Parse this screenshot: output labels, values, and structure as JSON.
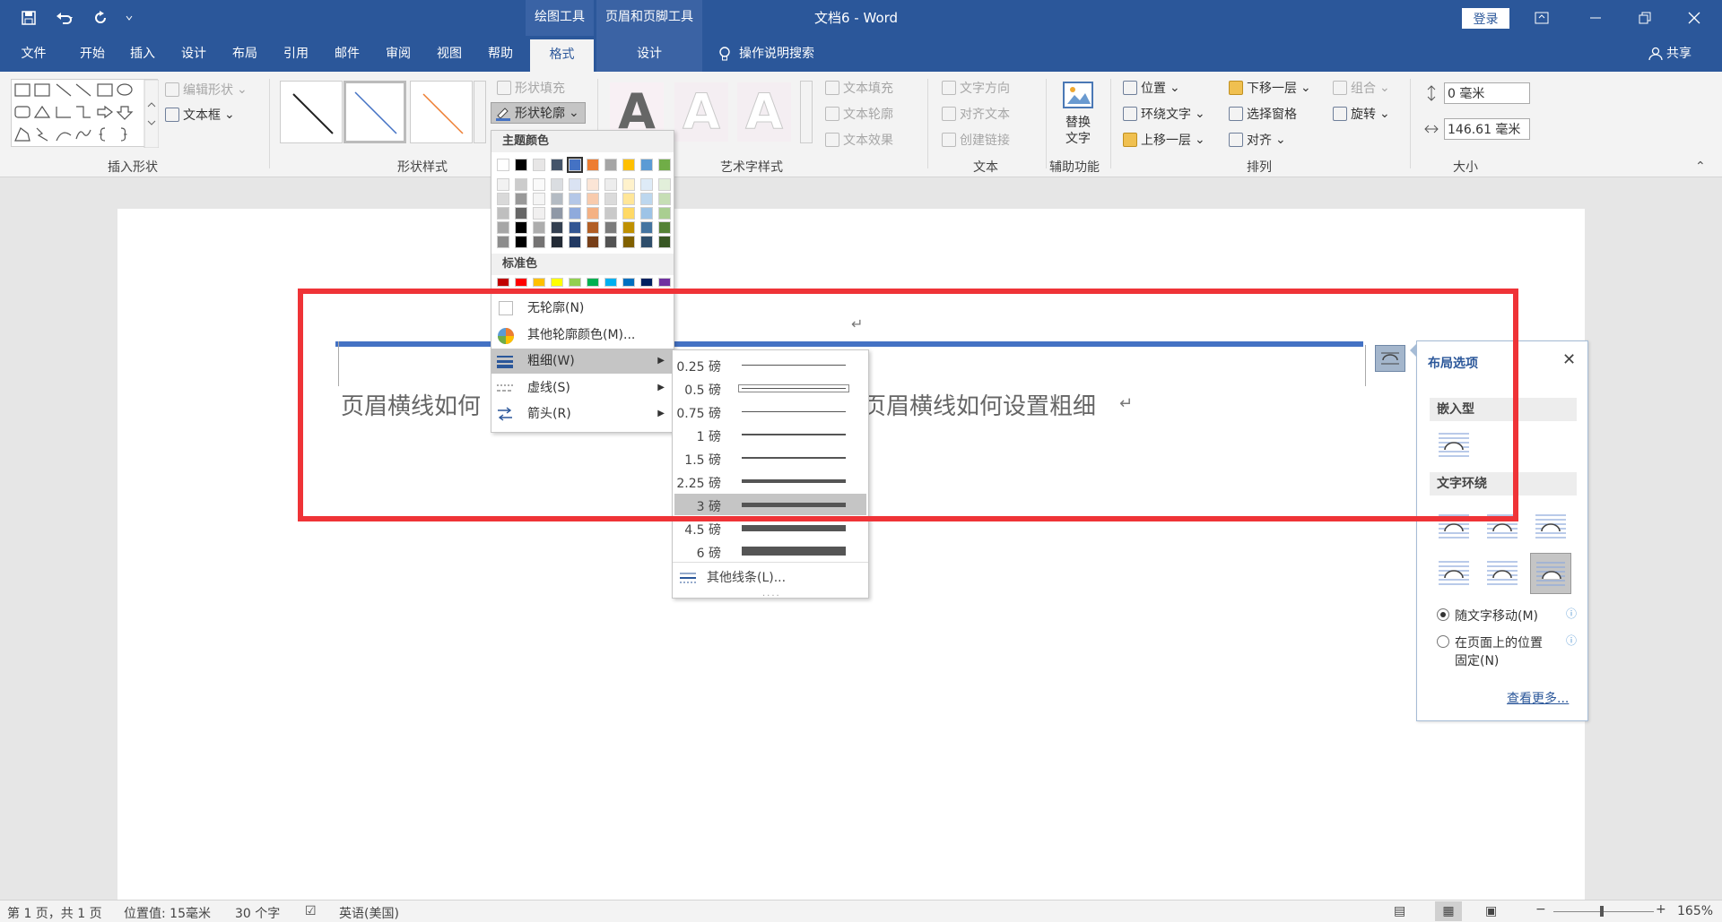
{
  "window": {
    "doc_title": "文档6 - Word",
    "context_tab_drawing": "绘图工具",
    "context_tab_header": "页眉和页脚工具",
    "login": "登录",
    "share": "共享"
  },
  "menu": {
    "tabs": [
      "文件",
      "开始",
      "插入",
      "设计",
      "布局",
      "引用",
      "邮件",
      "审阅",
      "视图",
      "帮助",
      "格式",
      "设计"
    ],
    "search": "操作说明搜索"
  },
  "ribbon": {
    "edit_shape": "编辑形状",
    "text_box": "文本框",
    "insert_shape_label": "插入形状",
    "shape_fill": "形状填充",
    "shape_outline": "形状轮廓",
    "shape_style_label": "形状样式",
    "text_fill": "文本填充",
    "text_outline": "文本轮廓",
    "text_effect": "文本效果",
    "art_label": "艺术字样式",
    "art_letter": "A",
    "text_direction": "文字方向",
    "align_text": "对齐文本",
    "create_link": "创建链接",
    "text_label": "文本",
    "alt_text_1": "替换",
    "alt_text_2": "文字",
    "access_label": "辅助功能",
    "position": "位置",
    "wrap_text": "环绕文字",
    "bring_forward": "上移一层",
    "send_backward": "下移一层",
    "selection_pane": "选择窗格",
    "align": "对齐",
    "group": "组合",
    "rotate": "旋转",
    "arrange_label": "排列",
    "height_value": "0 毫米",
    "width_value": "146.61 毫米",
    "size_label": "大小"
  },
  "document": {
    "text_left": "页眉横线如何",
    "text_right": "页眉横线如何设置粗细"
  },
  "outline_menu": {
    "theme_colors": "主题颜色",
    "standard_colors": "标准色",
    "no_outline": "无轮廓(N)",
    "more_colors": "其他轮廓颜色(M)...",
    "weight": "粗细(W)",
    "dashes": "虚线(S)",
    "arrows": "箭头(R)",
    "theme_row": [
      "#ffffff",
      "#000000",
      "#e7e6e6",
      "#44546a",
      "#4472c4",
      "#ed7d31",
      "#a5a5a5",
      "#ffc000",
      "#5b9bd5",
      "#70ad47"
    ],
    "standard_row": [
      "#c00000",
      "#ff0000",
      "#ffc000",
      "#ffff00",
      "#92d050",
      "#00b050",
      "#00b0f0",
      "#0070c0",
      "#002060",
      "#7030a0"
    ]
  },
  "weight_menu": {
    "items": [
      {
        "label": "0.25 磅",
        "pt": 0.25
      },
      {
        "label": "0.5 磅",
        "pt": 0.5
      },
      {
        "label": "0.75 磅",
        "pt": 0.75
      },
      {
        "label": "1 磅",
        "pt": 1
      },
      {
        "label": "1.5 磅",
        "pt": 1.5
      },
      {
        "label": "2.25 磅",
        "pt": 2.25
      },
      {
        "label": "3 磅",
        "pt": 3
      },
      {
        "label": "4.5 磅",
        "pt": 4.5
      },
      {
        "label": "6 磅",
        "pt": 6
      }
    ],
    "selected": "3 磅",
    "more": "其他线条(L)..."
  },
  "layout_panel": {
    "title": "布局选项",
    "inline": "嵌入型",
    "wrap": "文字环绕",
    "move_with_text": "随文字移动(M)",
    "fix_position_1": "在页面上的位置",
    "fix_position_2": "固定(N)",
    "see_more": "查看更多..."
  },
  "status": {
    "page": "第 1 页，共 1 页",
    "position": "位置值: 15毫米",
    "words": "30 个字",
    "language": "英语(美国)",
    "zoom": "165%"
  },
  "colors": {
    "brand": "#2b579a",
    "highlight_box": "#ef3337",
    "header_line": "#4472c4"
  }
}
